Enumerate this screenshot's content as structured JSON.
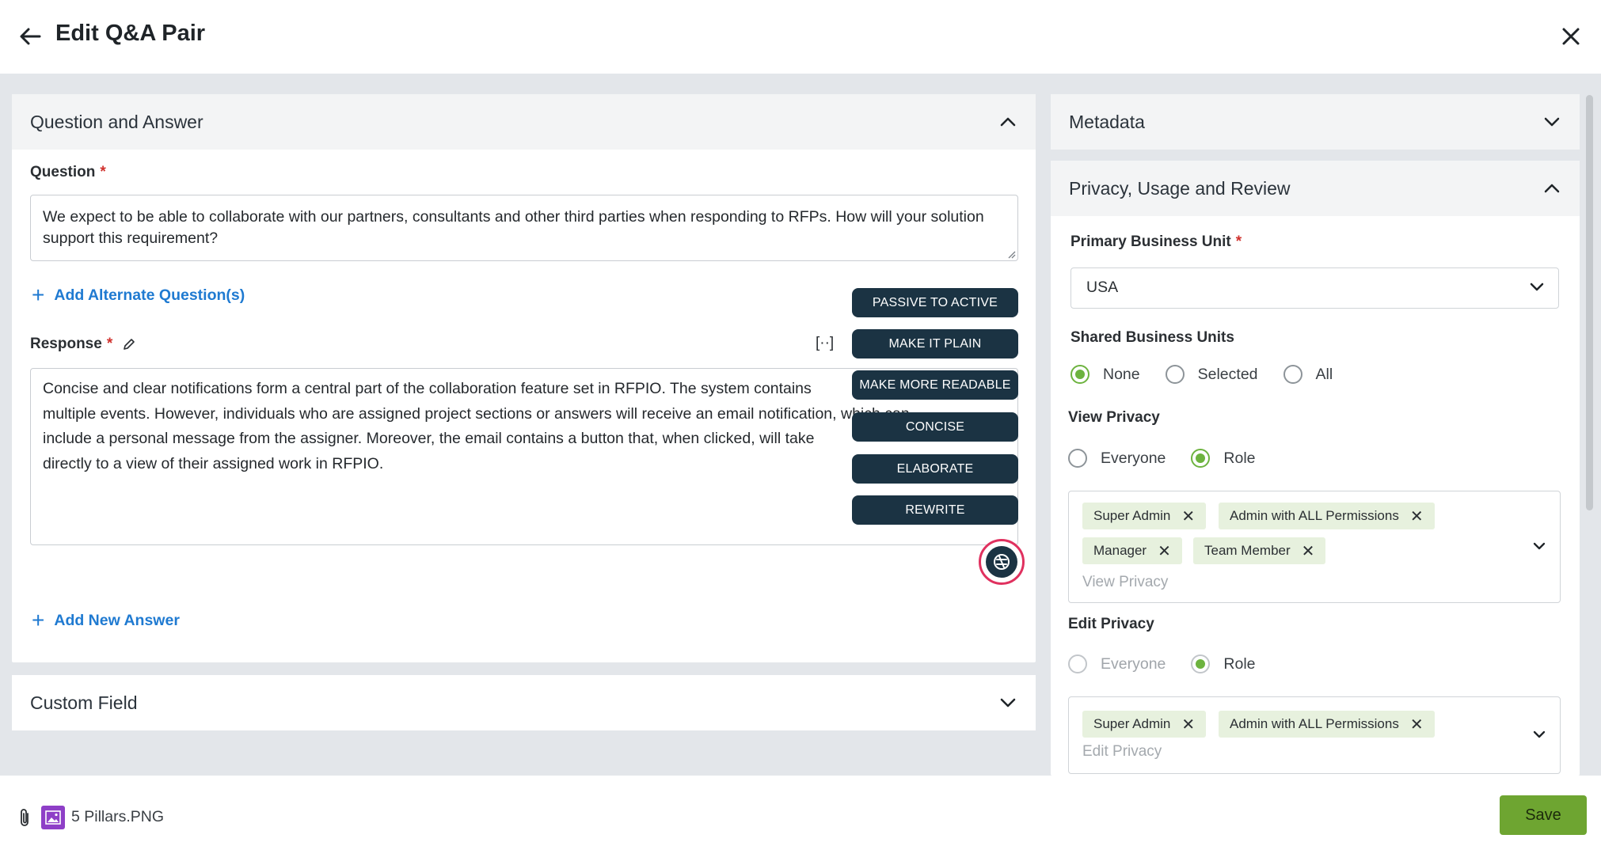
{
  "header": {
    "title": "Edit Q&A Pair"
  },
  "qa_section": {
    "title": "Question and Answer",
    "question_label": "Question",
    "question_text": "We expect to be able to collaborate with our partners, consultants and other third parties when responding to RFPs. How will your solution support this requirement?",
    "add_alternate_label": "Add Alternate Question(s)",
    "response_label": "Response",
    "response_tool_label": "[··]",
    "response_lines": [
      "Concise and clear notifications form a central part of the collaboration feature set in RFPIO. The system contains",
      "multiple events. However, individuals who are assigned project sections or answers will receive an email notification, which can",
      "include a personal message from the assigner. Moreover, the email contains a button that, when clicked, will take",
      "directly to a view of their assigned work in RFPIO."
    ],
    "add_answer_label": "Add New Answer"
  },
  "ai_menu": {
    "items": [
      "PASSIVE TO ACTIVE",
      "MAKE IT PLAIN",
      "MAKE MORE READABLE",
      "CONCISE",
      "ELABORATE",
      "REWRITE"
    ]
  },
  "custom_field": {
    "title": "Custom Field"
  },
  "metadata": {
    "title": "Metadata"
  },
  "privacy": {
    "title": "Privacy, Usage and Review",
    "primary_bu_label": "Primary Business Unit",
    "primary_bu_value": "USA",
    "shared_bu_label": "Shared Business Units",
    "shared_bu_options": [
      "None",
      "Selected",
      "All"
    ],
    "shared_bu_selected": "None",
    "view_privacy_label": "View Privacy",
    "view_privacy_options": [
      "Everyone",
      "Role"
    ],
    "view_privacy_selected": "Role",
    "view_roles": [
      "Super Admin",
      "Admin with ALL Permissions",
      "Manager",
      "Team Member"
    ],
    "view_placeholder": "View Privacy",
    "edit_privacy_label": "Edit Privacy",
    "edit_privacy_options": [
      "Everyone",
      "Role"
    ],
    "edit_privacy_selected": "Role",
    "edit_roles": [
      "Super Admin",
      "Admin with ALL Permissions"
    ],
    "edit_placeholder": "Edit Privacy"
  },
  "footer": {
    "attachment_name": "5 Pillars.PNG",
    "save_label": "Save"
  },
  "colors": {
    "accent_green": "#6ea531",
    "link_blue": "#1f7ad1",
    "ai_navy": "#1b3343",
    "required_red": "#d0312d"
  }
}
